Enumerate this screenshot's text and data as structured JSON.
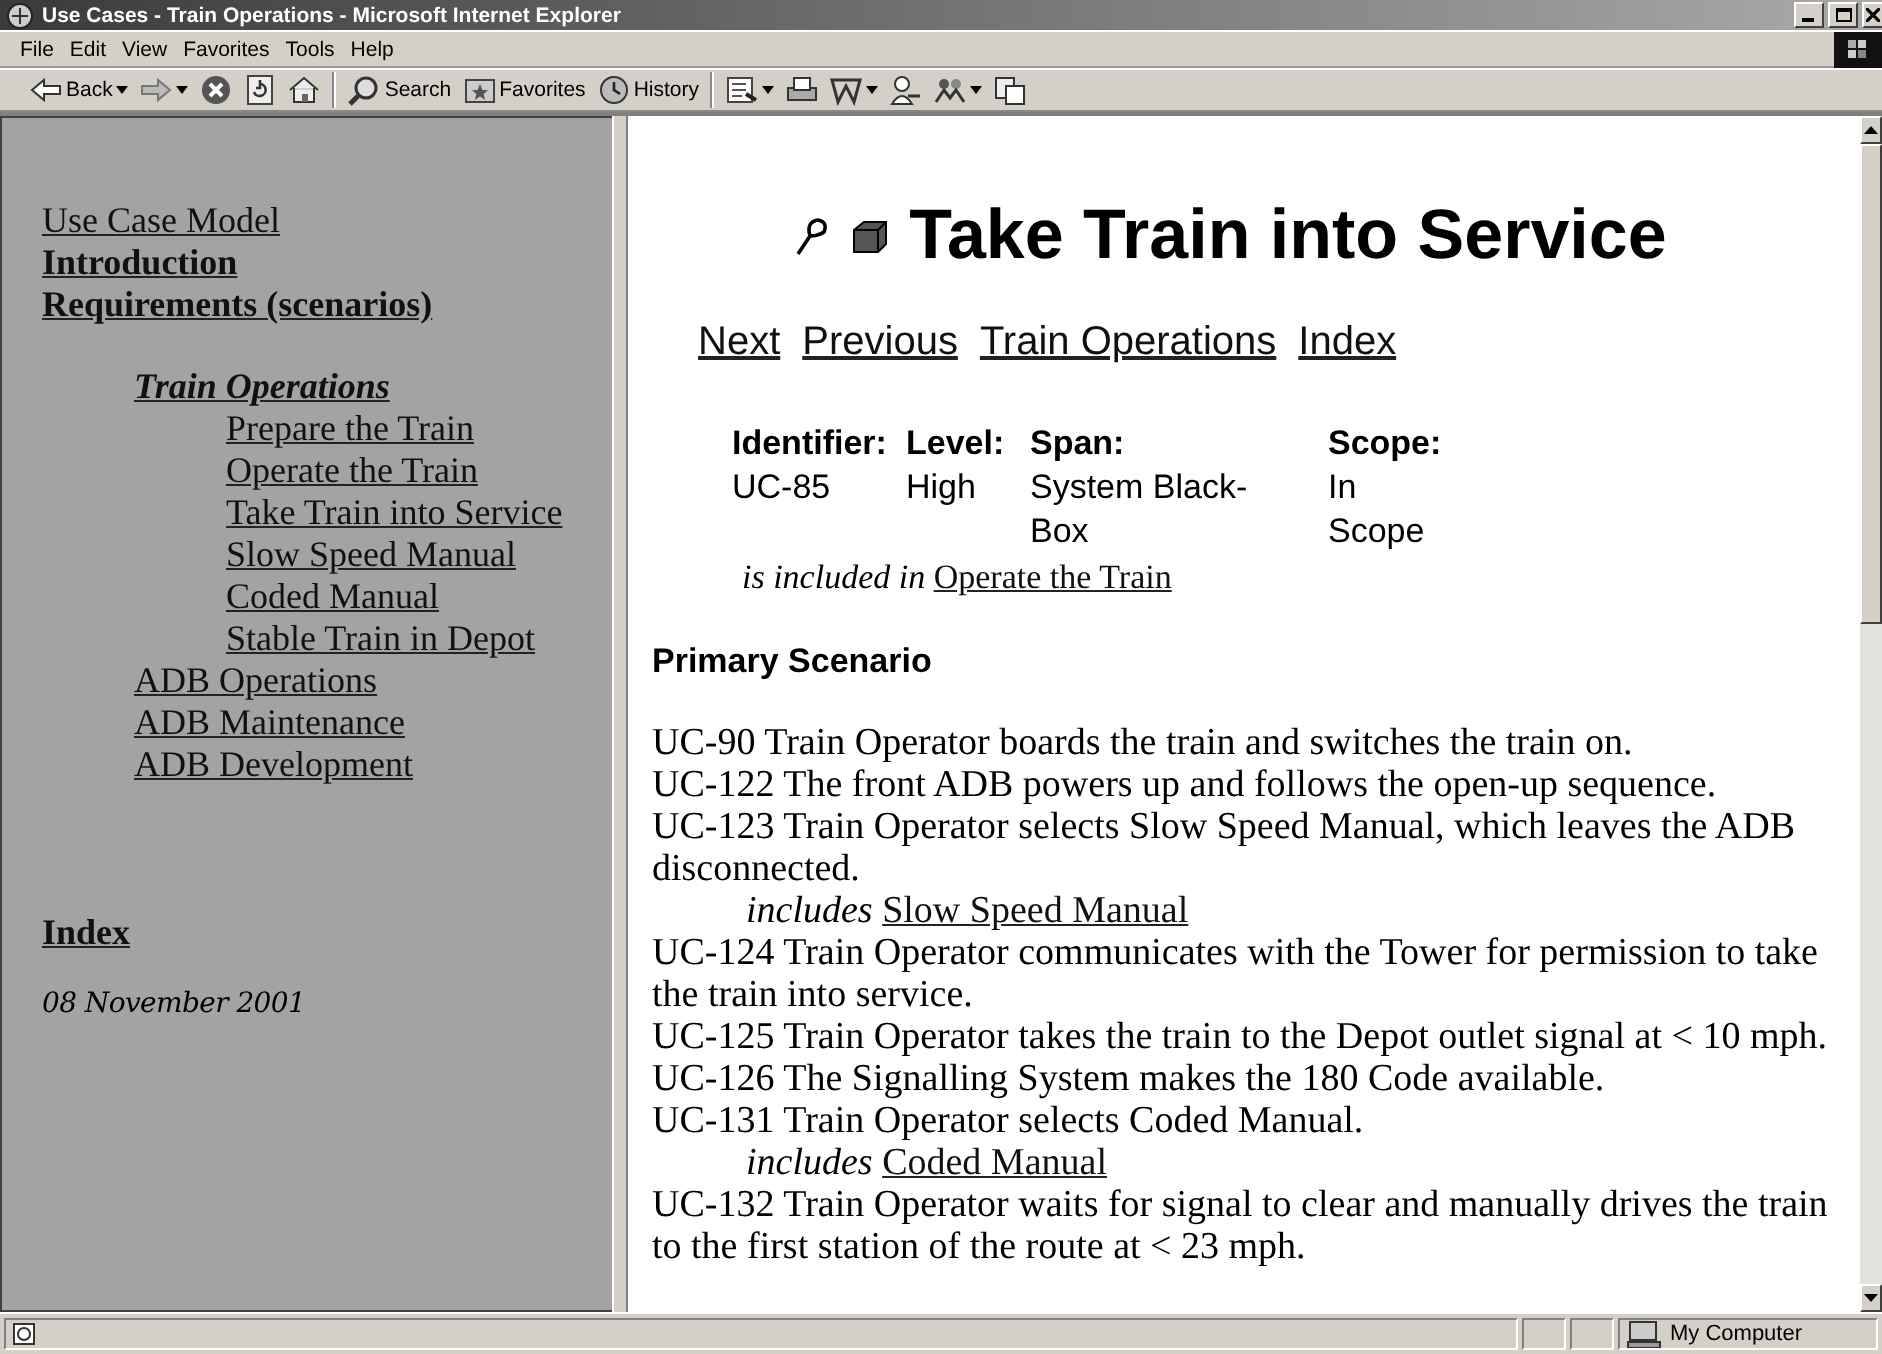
{
  "window": {
    "title": "Use Cases - Train Operations - Microsoft Internet Explorer"
  },
  "menu": [
    "File",
    "Edit",
    "View",
    "Favorites",
    "Tools",
    "Help"
  ],
  "toolbar": {
    "groups": [
      [
        {
          "kind": "back",
          "label": "Back",
          "dropdown": true
        },
        {
          "kind": "forward",
          "dropdown": true
        },
        {
          "kind": "stop",
          "dropdown": false
        },
        {
          "kind": "refresh",
          "dropdown": false
        },
        {
          "kind": "home",
          "dropdown": false
        }
      ],
      [
        {
          "kind": "search",
          "label": "Search",
          "dropdown": false
        },
        {
          "kind": "favorites",
          "label": "Favorites",
          "dropdown": false
        },
        {
          "kind": "history",
          "label": "History",
          "dropdown": false
        }
      ],
      [
        {
          "kind": "mail",
          "dropdown": true
        },
        {
          "kind": "print",
          "dropdown": false
        },
        {
          "kind": "edit",
          "dropdown": true
        },
        {
          "kind": "discuss",
          "dropdown": false
        },
        {
          "kind": "messenger",
          "dropdown": true
        },
        {
          "kind": "copy",
          "dropdown": false
        }
      ]
    ]
  },
  "sidebar": {
    "links": [
      {
        "label": "Use Case Model",
        "bold": false
      },
      {
        "label": "Introduction",
        "bold": true
      },
      {
        "label": "Requirements (scenarios)",
        "bold": true,
        "children": [
          {
            "label": "Train Operations",
            "selected": true,
            "children": [
              {
                "label": "Prepare the Train"
              },
              {
                "label": "Operate the Train"
              },
              {
                "label": "Take Train into Service"
              },
              {
                "label": "Slow Speed Manual"
              },
              {
                "label": "Coded Manual"
              },
              {
                "label": "Stable Train in Depot"
              }
            ]
          },
          {
            "label": "ADB Operations",
            "selected": false
          },
          {
            "label": "ADB Maintenance",
            "selected": false
          },
          {
            "label": "ADB Development",
            "selected": false
          }
        ]
      }
    ],
    "index_link": "Index",
    "date": "08 November 2001"
  },
  "page": {
    "title": "Take Train into Service",
    "nav_links": [
      "Next",
      "Previous",
      "Train Operations",
      "Index"
    ],
    "properties": [
      {
        "label": "Identifier:",
        "value": "UC-85"
      },
      {
        "label": "Level:",
        "value": "High"
      },
      {
        "label": "Span:",
        "value": "System Black-Box"
      },
      {
        "label": "Scope:",
        "value": "In Scope"
      }
    ],
    "included_in": {
      "prefix": "is included in",
      "link": "Operate the Train"
    },
    "section_heading": "Primary Scenario",
    "steps": [
      {
        "kind": "step",
        "text": "UC-90 Train Operator boards the train and switches the train on."
      },
      {
        "kind": "step",
        "text": "UC-122 The front ADB powers up and follows the open-up sequence."
      },
      {
        "kind": "step",
        "text": "UC-123 Train Operator selects Slow Speed Manual, which leaves the ADB disconnected."
      },
      {
        "kind": "include",
        "prefix": "includes",
        "link": "Slow Speed Manual"
      },
      {
        "kind": "step",
        "text": "UC-124 Train Operator communicates with the Tower for permission to take the train into service."
      },
      {
        "kind": "step",
        "text": "UC-125 Train Operator takes the train to the Depot outlet signal at < 10 mph."
      },
      {
        "kind": "step",
        "text": "UC-126 The Signalling System makes the 180 Code available."
      },
      {
        "kind": "step",
        "text": "UC-131 Train Operator selects Coded Manual."
      },
      {
        "kind": "include",
        "prefix": "includes",
        "link": "Coded Manual"
      },
      {
        "kind": "step",
        "text": "UC-132 Train Operator waits for signal to clear and manually drives the train to the first station of the route at < 23 mph."
      }
    ]
  },
  "status_bar": {
    "zone": "My Computer"
  }
}
